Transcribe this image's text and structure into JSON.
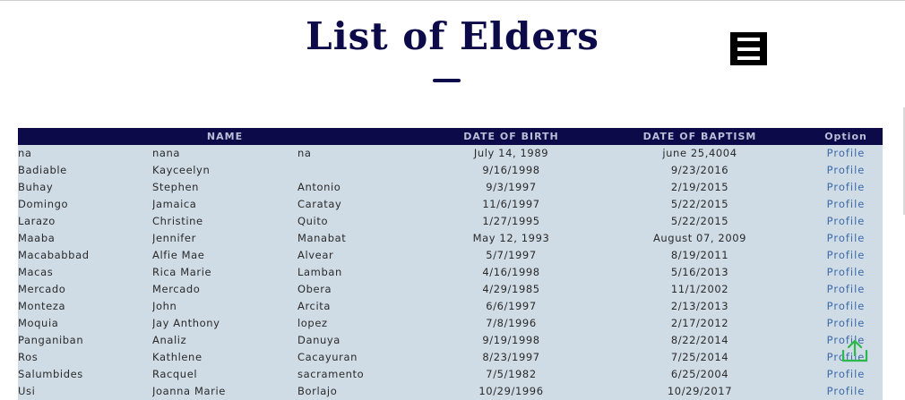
{
  "page": {
    "title": "List of Elders"
  },
  "menu": {
    "icon": "hamburger-menu-icon"
  },
  "table": {
    "headers": {
      "name": "NAME",
      "dob": "DATE OF BIRTH",
      "baptism": "DATE OF BAPTISM",
      "option": "Option"
    },
    "rows": [
      {
        "last": "na",
        "first": "nana",
        "middle": "na",
        "dob": "July 14, 1989",
        "baptism": "june 25,4004",
        "option": "Profile"
      },
      {
        "last": "Badiable",
        "first": "Kayceelyn",
        "middle": "",
        "dob": "9/16/1998",
        "baptism": "9/23/2016",
        "option": "Profile"
      },
      {
        "last": "Buhay",
        "first": "Stephen",
        "middle": "Antonio",
        "dob": "9/3/1997",
        "baptism": "2/19/2015",
        "option": "Profile"
      },
      {
        "last": "Domingo",
        "first": "Jamaica",
        "middle": "Caratay",
        "dob": "11/6/1997",
        "baptism": "5/22/2015",
        "option": "Profile"
      },
      {
        "last": "Larazo",
        "first": "Christine",
        "middle": "Quito",
        "dob": "1/27/1995",
        "baptism": "5/22/2015",
        "option": "Profile"
      },
      {
        "last": "Maaba",
        "first": "Jennifer",
        "middle": "Manabat",
        "dob": "May 12, 1993",
        "baptism": "August 07, 2009",
        "option": "Profile"
      },
      {
        "last": "Macababbad",
        "first": "Alfie Mae",
        "middle": "Alvear",
        "dob": "5/7/1997",
        "baptism": "8/19/2011",
        "option": "Profile"
      },
      {
        "last": "Macas",
        "first": "Rica Marie",
        "middle": "Lamban",
        "dob": "4/16/1998",
        "baptism": "5/16/2013",
        "option": "Profile"
      },
      {
        "last": "Mercado",
        "first": "Mercado",
        "middle": "Obera",
        "dob": "4/29/1985",
        "baptism": "11/1/2002",
        "option": "Profile"
      },
      {
        "last": "Monteza",
        "first": "John",
        "middle": "Arcita",
        "dob": "6/6/1997",
        "baptism": "2/13/2013",
        "option": "Profile"
      },
      {
        "last": "Moquia",
        "first": "Jay Anthony",
        "middle": "lopez",
        "dob": "7/8/1996",
        "baptism": "2/17/2012",
        "option": "Profile"
      },
      {
        "last": "Panganiban",
        "first": "Analiz",
        "middle": "Danuya",
        "dob": "9/19/1998",
        "baptism": "8/22/2014",
        "option": "Profile"
      },
      {
        "last": "Ros",
        "first": "Kathlene",
        "middle": "Cacayuran",
        "dob": "8/23/1997",
        "baptism": "7/25/2014",
        "option": "Profile"
      },
      {
        "last": "Salumbides",
        "first": "Racquel",
        "middle": "sacramento",
        "dob": "7/5/1982",
        "baptism": "6/25/2004",
        "option": "Profile"
      },
      {
        "last": "Usi",
        "first": "Joanna Marie",
        "middle": "Borlajo",
        "dob": "10/29/1996",
        "baptism": "10/29/2017",
        "option": "Profile"
      }
    ]
  },
  "scroll_top": {
    "icon": "scroll-to-top-icon",
    "color": "#2db84d"
  },
  "colors": {
    "header_bg": "#0d0a4a",
    "row_bg": "#cfdbe5",
    "link": "#3d6aa8",
    "title": "#0d0a4a"
  }
}
